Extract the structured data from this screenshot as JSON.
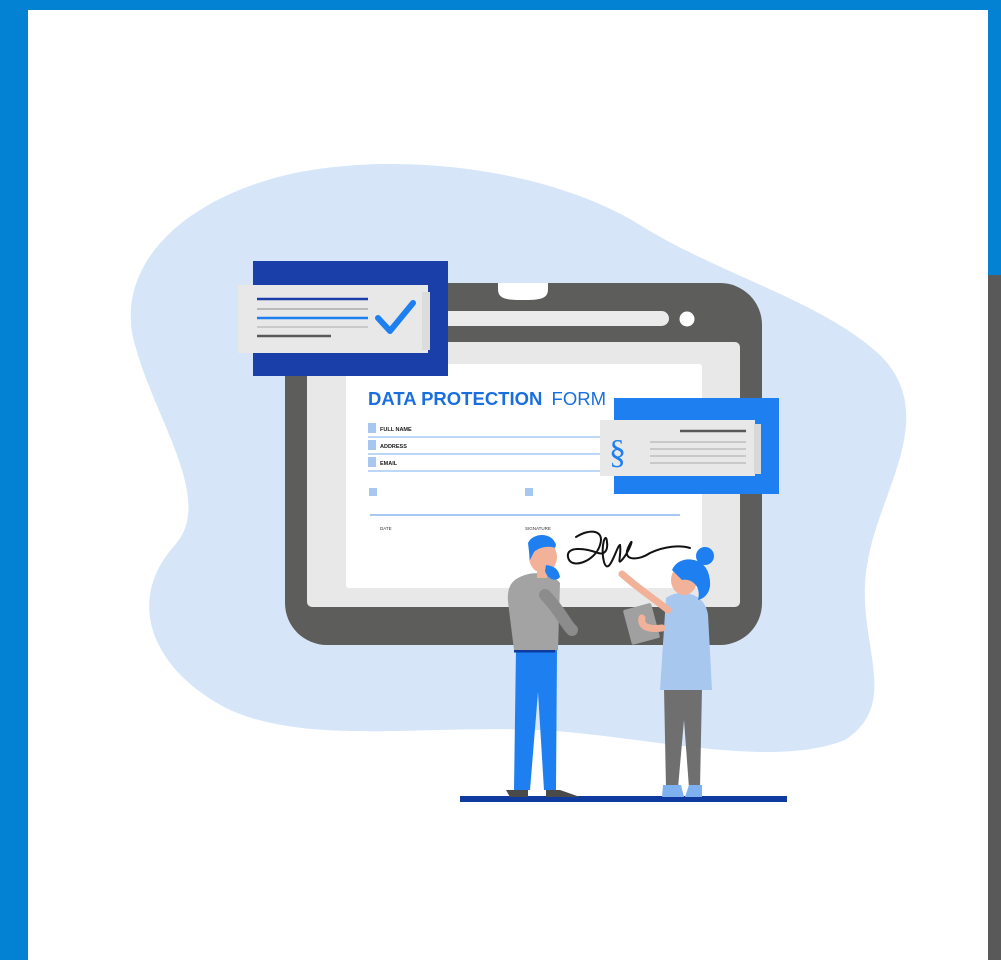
{
  "form": {
    "title_bold": "DATA PROTECTION",
    "title_light": "FORM",
    "fields": [
      "FULL NAME",
      "ADDRESS",
      "EMAIL"
    ],
    "date_label": "DATE",
    "signature_label": "SIGNATURE"
  },
  "legal_card": {
    "symbol": "§"
  },
  "colors": {
    "frame_blue": "#0381d3",
    "blob": "#d6e6f8",
    "tablet": "#5d5e5c",
    "navy": "#1a3fa8",
    "accent_blue": "#1e7ff0",
    "ground": "#0f3aa0"
  },
  "icons": [
    "checkmark-icon",
    "section-sign-icon",
    "signature-scribble"
  ]
}
